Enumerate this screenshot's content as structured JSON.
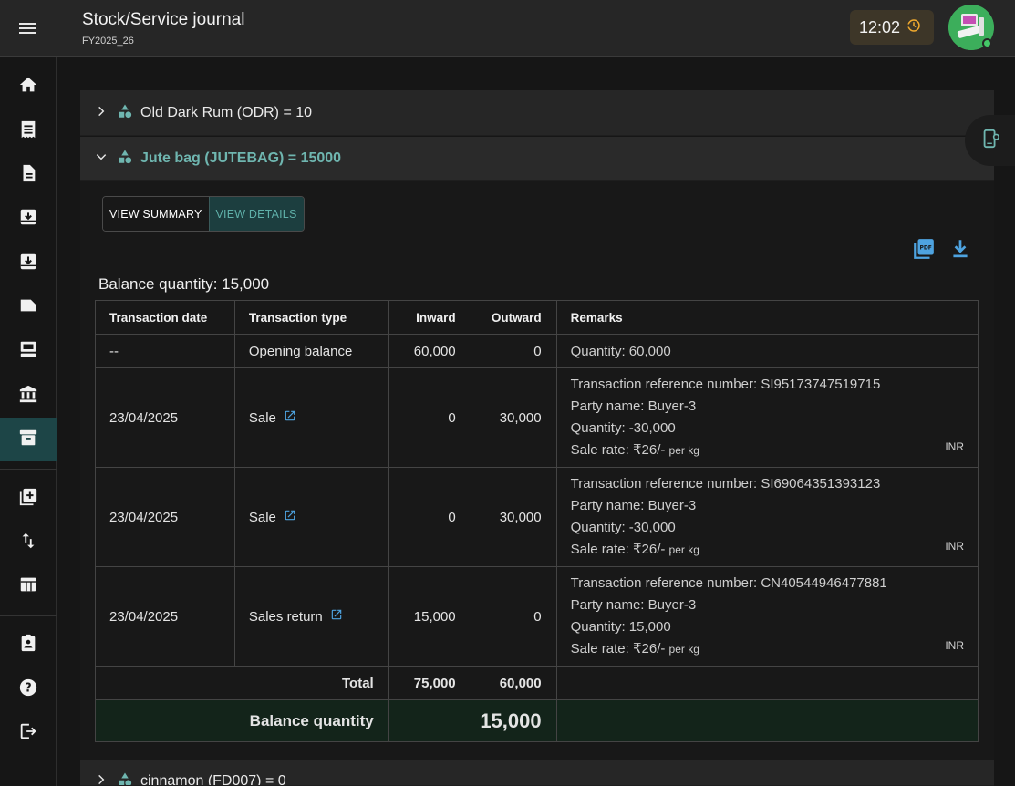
{
  "header": {
    "title": "Stock/Service journal",
    "subtitle": "FY2025_26",
    "clock": "12:02"
  },
  "sidebar": {
    "items": [
      {
        "icon": "home-icon"
      },
      {
        "icon": "receipt-icon"
      },
      {
        "icon": "document-icon"
      },
      {
        "icon": "inbox-in-icon"
      },
      {
        "icon": "inbox-out-icon"
      },
      {
        "icon": "label-icon"
      },
      {
        "icon": "point-of-sale-icon"
      },
      {
        "icon": "bank-icon"
      },
      {
        "icon": "archive-icon",
        "active": true
      },
      {
        "icon": "add-box-icon"
      },
      {
        "icon": "swap-vert-icon"
      },
      {
        "icon": "table-icon"
      },
      {
        "icon": "assignment-icon"
      },
      {
        "icon": "help-icon"
      },
      {
        "icon": "logout-icon"
      }
    ]
  },
  "items": {
    "odr": "Old Dark Rum (ODR) = 10",
    "jute": "Jute bag (JUTEBAG) = 15000",
    "cinnamon": "cinnamon (FD007) = 0"
  },
  "view": {
    "summary": "VIEW SUMMARY",
    "details": "VIEW DETAILS"
  },
  "balance_text": "Balance quantity: 15,000",
  "table": {
    "headers": [
      "Transaction date",
      "Transaction type",
      "Inward",
      "Outward",
      "Remarks"
    ],
    "opening": {
      "date": "--",
      "type": "Opening balance",
      "inward": "60,000",
      "outward": "0",
      "remark": "Quantity: 60,000"
    },
    "rows": [
      {
        "date": "23/04/2025",
        "type": "Sale",
        "inward": "0",
        "outward": "30,000",
        "ref": "Transaction reference number: SI95173747519715",
        "party": "Party name: Buyer-3",
        "qty": "Quantity: -30,000",
        "rate": "Sale rate: ₹26/-",
        "unit": "per kg",
        "currency": "INR"
      },
      {
        "date": "23/04/2025",
        "type": "Sale",
        "inward": "0",
        "outward": "30,000",
        "ref": "Transaction reference number: SI69064351393123",
        "party": "Party name: Buyer-3",
        "qty": "Quantity: -30,000",
        "rate": "Sale rate: ₹26/-",
        "unit": "per kg",
        "currency": "INR"
      },
      {
        "date": "23/04/2025",
        "type": "Sales return",
        "inward": "15,000",
        "outward": "0",
        "ref": "Transaction reference number: CN40544946477881",
        "party": "Party name: Buyer-3",
        "qty": "Quantity: 15,000",
        "rate": "Sale rate: ₹26/-",
        "unit": "per kg",
        "currency": "INR"
      }
    ],
    "total": {
      "label": "Total",
      "inward": "75,000",
      "outward": "60,000"
    },
    "balance": {
      "label": "Balance quantity",
      "value": "15,000"
    }
  },
  "colors": {
    "accent": "#6fb6b0",
    "active_nav": "#1d4547",
    "balance_row": "#13241a"
  }
}
